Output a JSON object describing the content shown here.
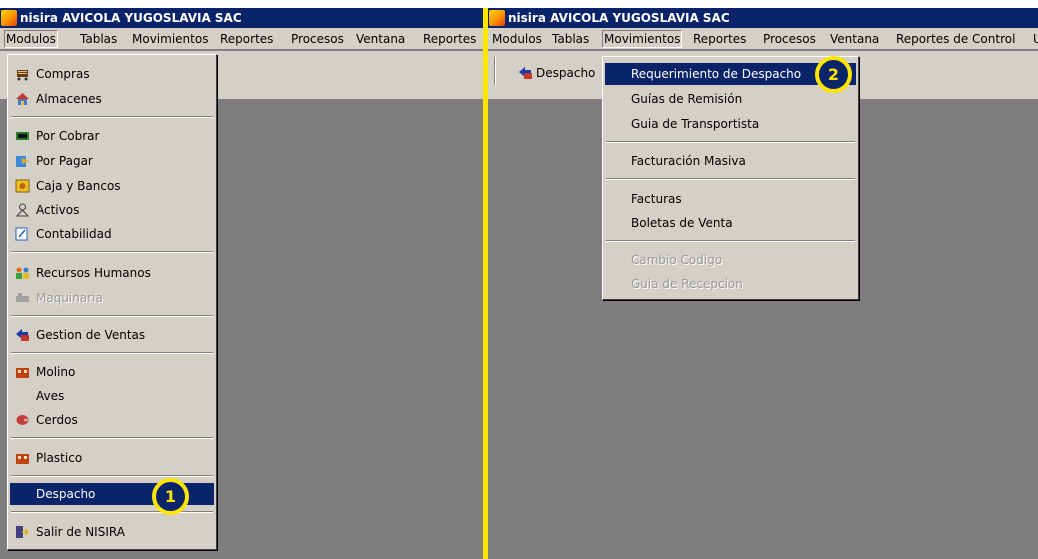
{
  "left_window": {
    "title": "nisira AVICOLA YUGOSLAVIA SAC",
    "menubar": [
      "Modulos",
      "Tablas",
      "Movimientos",
      "Reportes",
      "Procesos",
      "Ventana",
      "Reportes"
    ],
    "modulos_menu": {
      "items": [
        {
          "label": "Compras",
          "icon": "cart-icon"
        },
        {
          "label": "Almacenes",
          "icon": "warehouse-icon"
        },
        {
          "label": "Por Cobrar",
          "icon": "money-icon"
        },
        {
          "label": "Por Pagar",
          "icon": "payment-icon"
        },
        {
          "label": "Caja y Bancos",
          "icon": "safe-icon"
        },
        {
          "label": "Activos",
          "icon": "assets-icon"
        },
        {
          "label": "Contabilidad",
          "icon": "accounting-icon"
        },
        {
          "label": "Recursos Humanos",
          "icon": "people-icon"
        },
        {
          "label": "Maquinaria",
          "icon": "machine-icon"
        },
        {
          "label": "Gestion de Ventas",
          "icon": "sales-icon"
        },
        {
          "label": "Molino",
          "icon": "mill-icon"
        },
        {
          "label": "Aves",
          "icon": ""
        },
        {
          "label": "Cerdos",
          "icon": "pig-icon"
        },
        {
          "label": "Plastico",
          "icon": "plastic-icon"
        },
        {
          "label": "Despacho",
          "icon": ""
        },
        {
          "label": "Salir de NISIRA",
          "icon": "exit-icon"
        }
      ]
    },
    "callout": "1"
  },
  "right_window": {
    "title": "nisira AVICOLA YUGOSLAVIA SAC",
    "menubar": [
      "Modulos",
      "Tablas",
      "Movimientos",
      "Reportes",
      "Procesos",
      "Ventana",
      "Reportes de Control",
      "U"
    ],
    "toolbar": {
      "despacho_label": "Despacho"
    },
    "movimientos_menu": {
      "items": [
        {
          "label": "Requerimiento de Despacho"
        },
        {
          "label": "Guías de Remisión"
        },
        {
          "label": "Guia de Transportista"
        },
        {
          "label": "Facturación Masiva"
        },
        {
          "label": "Facturas"
        },
        {
          "label": "Boletas de Venta"
        },
        {
          "label": "Cambio Codigo"
        },
        {
          "label": "Guia de Recepcion"
        }
      ]
    },
    "callout": "2"
  },
  "colors": {
    "highlight": "#0a246a",
    "callout": "#ffe600",
    "menu_bg": "#d4d0c8",
    "workspace": "#807d80"
  }
}
